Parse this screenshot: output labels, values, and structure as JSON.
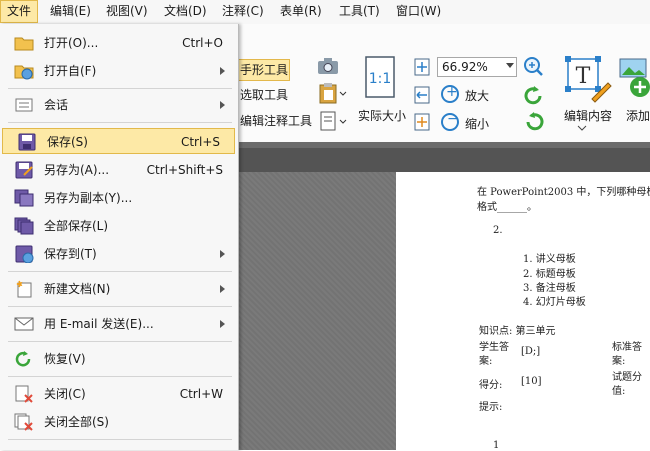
{
  "menubar": [
    "文件",
    "编辑(E)",
    "视图(V)",
    "文档(D)",
    "注释(C)",
    "表单(R)",
    "工具(T)",
    "窗口(W)"
  ],
  "ribbon": {
    "hand_tool": "手形工具",
    "select_text": "选取工具",
    "edit_annot": "编辑注释工具",
    "actual_size_icon": "1:1",
    "actual_size": "实际大小",
    "zoom_value": "66.92%",
    "zoom_in": "放大",
    "zoom_out": "缩小",
    "edit_content": "编辑内容",
    "add": "添加"
  },
  "file_menu": [
    {
      "label": "打开(O)...",
      "shortcut": "Ctrl+O",
      "submenu": false,
      "icon": "folder-icon"
    },
    {
      "label": "打开自(F)",
      "shortcut": "",
      "submenu": true,
      "icon": "folder-globe-icon"
    },
    {
      "label": "会话",
      "shortcut": "",
      "submenu": true,
      "icon": "session-icon"
    },
    {
      "label": "保存(S)",
      "shortcut": "Ctrl+S",
      "submenu": false,
      "icon": "save-icon"
    },
    {
      "label": "另存为(A)...",
      "shortcut": "Ctrl+Shift+S",
      "submenu": false,
      "icon": "save-as-icon"
    },
    {
      "label": "另存为副本(Y)...",
      "shortcut": "",
      "submenu": false,
      "icon": "save-copy-icon"
    },
    {
      "label": "全部保存(L)",
      "shortcut": "",
      "submenu": false,
      "icon": "save-all-icon"
    },
    {
      "label": "保存到(T)",
      "shortcut": "",
      "submenu": true,
      "icon": "save-to-icon"
    },
    {
      "label": "新建文档(N)",
      "shortcut": "",
      "submenu": true,
      "icon": "new-document-icon"
    },
    {
      "label": "用 E-mail 发送(E)...",
      "shortcut": "",
      "submenu": true,
      "icon": "email-icon"
    },
    {
      "label": "恢复(V)",
      "shortcut": "",
      "submenu": false,
      "icon": "revert-icon"
    },
    {
      "label": "关闭(C)",
      "shortcut": "Ctrl+W",
      "submenu": false,
      "icon": "close-doc-icon"
    },
    {
      "label": "关闭全部(S)",
      "shortcut": "",
      "submenu": false,
      "icon": "close-all-icon"
    }
  ],
  "page": {
    "question_line1": "在 PowerPoint2003 中，下列哪种母板",
    "question_line2": "格式______。",
    "num": "2.",
    "options": [
      "1.   讲义母板",
      "2.   标题母板",
      "3.   备注母板",
      "4.   幻灯片母板"
    ],
    "knowledge": "知识点: 第三单元",
    "student_answer_label1": "学生答",
    "student_answer_label2": "案:",
    "student_answer": "[D;]",
    "std_answer_label1": "标准答",
    "std_answer_label2": "案:",
    "score_label": "得分:",
    "score": "[10]",
    "item_score_label1": "试题分",
    "item_score_label2": "值:",
    "hint": "提示:",
    "next_num": "1"
  }
}
